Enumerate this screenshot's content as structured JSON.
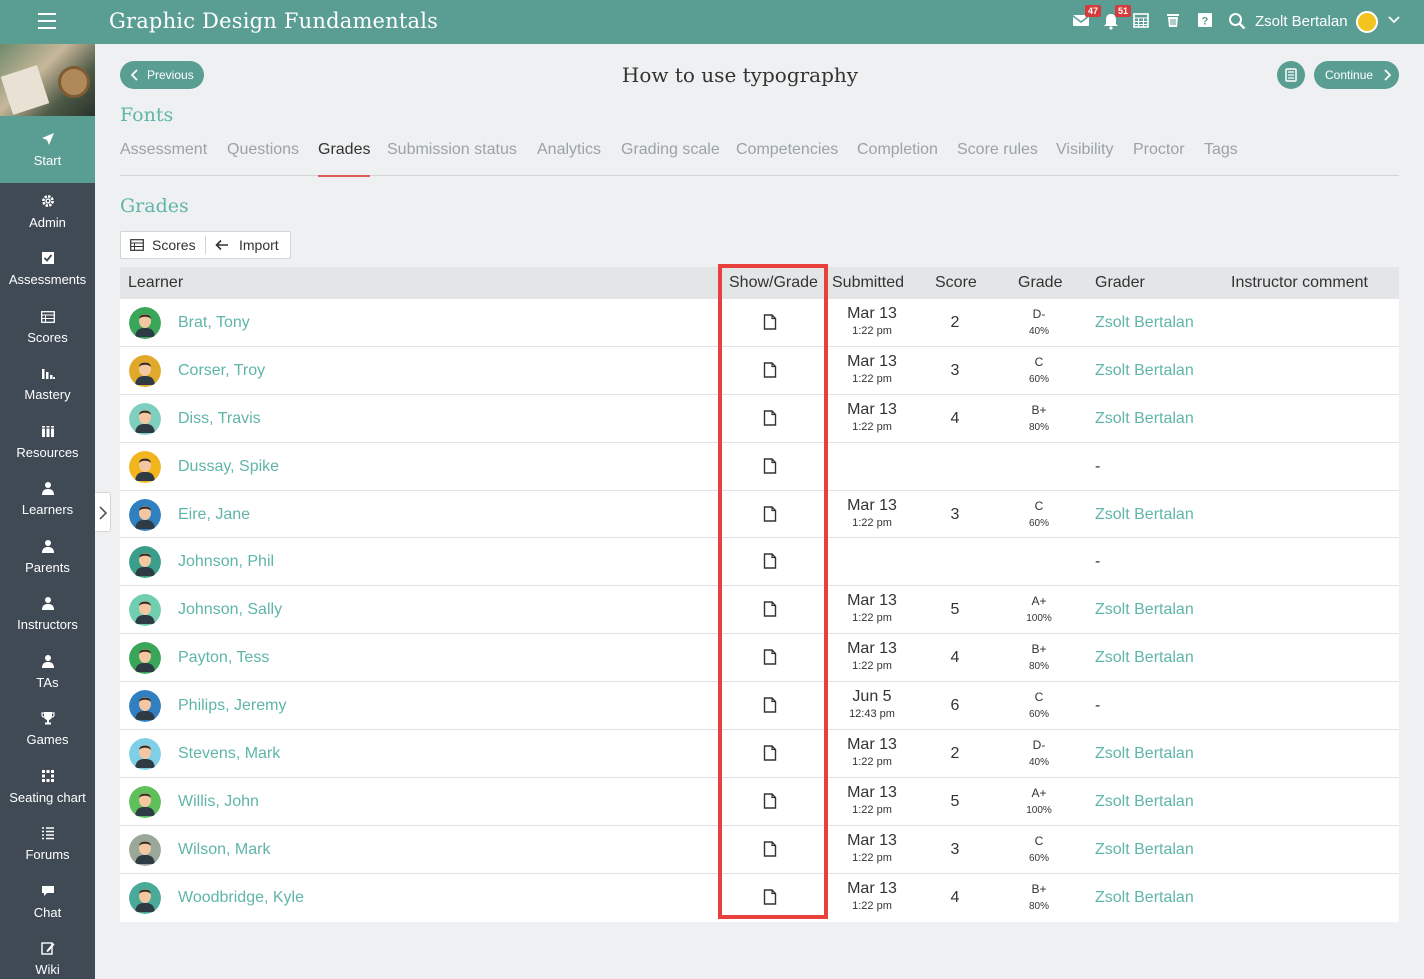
{
  "topbar": {
    "course_title": "Graphic Design Fundamentals",
    "mail_badge": "47",
    "notifications_badge": "51",
    "user_name": "Zsolt Bertalan"
  },
  "sidebar": {
    "items": [
      {
        "label": "Start",
        "icon": "navigate-arrow-icon"
      },
      {
        "label": "Admin",
        "icon": "gear-icon"
      },
      {
        "label": "Assessments",
        "icon": "checkbox-icon"
      },
      {
        "label": "Scores",
        "icon": "gradebook-icon"
      },
      {
        "label": "Mastery",
        "icon": "bar-chart-icon"
      },
      {
        "label": "Resources",
        "icon": "books-icon"
      },
      {
        "label": "Learners",
        "icon": "person-icon"
      },
      {
        "label": "Parents",
        "icon": "person-icon"
      },
      {
        "label": "Instructors",
        "icon": "person-icon"
      },
      {
        "label": "TAs",
        "icon": "person-icon"
      },
      {
        "label": "Games",
        "icon": "trophy-icon"
      },
      {
        "label": "Seating chart",
        "icon": "grid-icon"
      },
      {
        "label": "Forums",
        "icon": "list-icon"
      },
      {
        "label": "Chat",
        "icon": "chat-bubble-icon"
      },
      {
        "label": "Wiki",
        "icon": "edit-icon"
      }
    ]
  },
  "header": {
    "previous_label": "Previous",
    "continue_label": "Continue",
    "page_title": "How to use typography",
    "section_title": "Fonts"
  },
  "tabs": [
    "Assessment",
    "Questions",
    "Grades",
    "Submission status",
    "Analytics",
    "Grading scale",
    "Competencies",
    "Completion",
    "Score rules",
    "Visibility",
    "Proctor",
    "Tags"
  ],
  "active_tab": "Grades",
  "grades": {
    "title": "Grades",
    "scores_label": "Scores",
    "import_label": "Import",
    "columns": [
      "Learner",
      "Show/Grade",
      "Submitted",
      "Score",
      "Grade",
      "Grader",
      "Instructor comment"
    ],
    "rows": [
      {
        "learner": "Brat, Tony",
        "date": "Mar 13",
        "time": "1:22 pm",
        "score": "2",
        "grade": "D-",
        "pct": "40%",
        "grader": "Zsolt Bertalan",
        "avatar": "#3aa65a"
      },
      {
        "learner": "Corser, Troy",
        "date": "Mar 13",
        "time": "1:22 pm",
        "score": "3",
        "grade": "C",
        "pct": "60%",
        "grader": "Zsolt Bertalan",
        "avatar": "#e0a92a"
      },
      {
        "learner": "Diss, Travis",
        "date": "Mar 13",
        "time": "1:22 pm",
        "score": "4",
        "grade": "B+",
        "pct": "80%",
        "grader": "Zsolt Bertalan",
        "avatar": "#7fcfc0"
      },
      {
        "learner": "Dussay, Spike",
        "date": "",
        "time": "",
        "score": "",
        "grade": "",
        "pct": "",
        "grader": "-",
        "avatar": "#f2b51e"
      },
      {
        "learner": "Eire, Jane",
        "date": "Mar 13",
        "time": "1:22 pm",
        "score": "3",
        "grade": "C",
        "pct": "60%",
        "grader": "Zsolt Bertalan",
        "avatar": "#2f7fc1"
      },
      {
        "learner": "Johnson, Phil",
        "date": "",
        "time": "",
        "score": "",
        "grade": "",
        "pct": "",
        "grader": "-",
        "avatar": "#3a9e8a"
      },
      {
        "learner": "Johnson, Sally",
        "date": "Mar 13",
        "time": "1:22 pm",
        "score": "5",
        "grade": "A+",
        "pct": "100%",
        "grader": "Zsolt Bertalan",
        "avatar": "#6fcfb0"
      },
      {
        "learner": "Payton, Tess",
        "date": "Mar 13",
        "time": "1:22 pm",
        "score": "4",
        "grade": "B+",
        "pct": "80%",
        "grader": "Zsolt Bertalan",
        "avatar": "#3aa65a"
      },
      {
        "learner": "Philips, Jeremy",
        "date": "Jun 5",
        "time": "12:43 pm",
        "score": "6",
        "grade": "C",
        "pct": "60%",
        "grader": "-",
        "avatar": "#2f7fc1"
      },
      {
        "learner": "Stevens, Mark",
        "date": "Mar 13",
        "time": "1:22 pm",
        "score": "2",
        "grade": "D-",
        "pct": "40%",
        "grader": "Zsolt Bertalan",
        "avatar": "#7fd0e6"
      },
      {
        "learner": "Willis, John",
        "date": "Mar 13",
        "time": "1:22 pm",
        "score": "5",
        "grade": "A+",
        "pct": "100%",
        "grader": "Zsolt Bertalan",
        "avatar": "#5fbf5a"
      },
      {
        "learner": "Wilson, Mark",
        "date": "Mar 13",
        "time": "1:22 pm",
        "score": "3",
        "grade": "C",
        "pct": "60%",
        "grader": "Zsolt Bertalan",
        "avatar": "#9aa89a"
      },
      {
        "learner": "Woodbridge, Kyle",
        "date": "Mar 13",
        "time": "1:22 pm",
        "score": "4",
        "grade": "B+",
        "pct": "80%",
        "grader": "Zsolt Bertalan",
        "avatar": "#4aaa9a"
      }
    ]
  },
  "colors": {
    "accent": "#5a9e93",
    "link": "#5fb5a8",
    "sidebar": "#3f4a55",
    "highlight": "#e8403a"
  }
}
